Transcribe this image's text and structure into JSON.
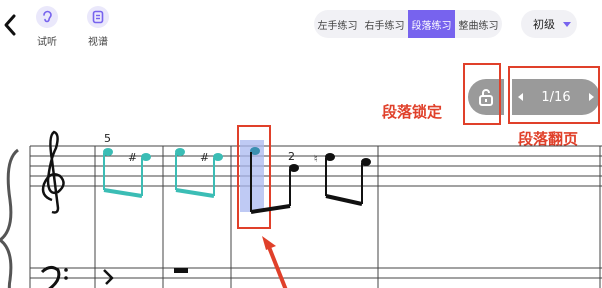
{
  "toolbar": {
    "tools": [
      {
        "label": "试听",
        "icon": "ear-icon"
      },
      {
        "label": "视谱",
        "icon": "score-view-icon"
      }
    ],
    "tabs": [
      {
        "label": "左手练习",
        "active": false
      },
      {
        "label": "右手练习",
        "active": false
      },
      {
        "label": "段落练习",
        "active": true
      },
      {
        "label": "整曲练习",
        "active": false
      }
    ],
    "level": "初级",
    "accent_color": "#7763ee"
  },
  "controls": {
    "pager_text": "1/16",
    "lock_label": "段落锁定",
    "page_label": "段落翻页",
    "annotation_color": "#e0402a"
  },
  "score": {
    "finger_5": "5",
    "finger_2": "2",
    "sharp_1": "#",
    "sharp_2": "#",
    "natural": "♮",
    "note_color": "#3bbdb5",
    "highlight_color": "#a9b8f0"
  }
}
